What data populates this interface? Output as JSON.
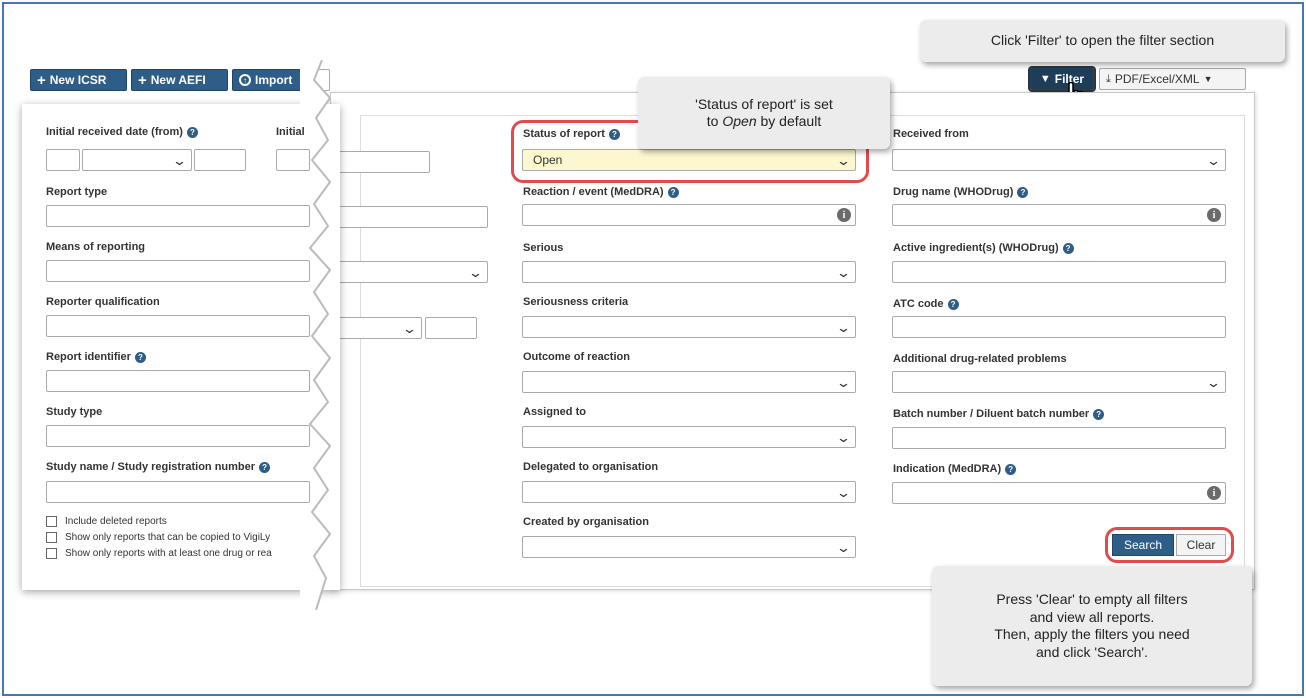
{
  "toolbar": {
    "new_icsr": "New ICSR",
    "new_aefi": "New AEFI",
    "import": "Import",
    "filter": "Filter",
    "export": "PDF/Excel/XML"
  },
  "left": {
    "initial_received_from": "Initial received date (from)",
    "initial_trunc": "Initial",
    "report_type": "Report type",
    "means_of_reporting": "Means of reporting",
    "reporter_qualification": "Reporter qualification",
    "report_identifier": "Report identifier",
    "study_type": "Study type",
    "study_name": "Study name / Study registration number",
    "checkboxes": [
      "Include deleted reports",
      "Show only reports that can be copied to VigiLy",
      "Show only reports with at least one drug or rea"
    ]
  },
  "middle": {
    "status_of_report": "Status of report",
    "status_value": "Open",
    "reaction_event": "Reaction / event (MedDRA)",
    "serious": "Serious",
    "seriousness_criteria": "Seriousness criteria",
    "outcome_of_reaction": "Outcome of reaction",
    "assigned_to": "Assigned to",
    "delegated_to_org": "Delegated to organisation",
    "created_by_org": "Created by organisation"
  },
  "right": {
    "received_from": "Received from",
    "drug_name": "Drug name (WHODrug)",
    "active_ingredient": "Active ingredient(s) (WHODrug)",
    "atc_code": "ATC code",
    "additional_drug": "Additional drug-related problems",
    "batch_number": "Batch number / Diluent batch number",
    "indication": "Indication (MedDRA)"
  },
  "buttons": {
    "search": "Search",
    "clear": "Clear"
  },
  "callouts": {
    "filter_tip": "Click 'Filter' to open the filter section",
    "status_tip_1": "'Status of report' is set",
    "status_tip_2_pre": "to ",
    "status_tip_2_em": "Open",
    "status_tip_2_post": " by default",
    "clear_tip_1": "Press 'Clear' to empty all filters",
    "clear_tip_2": "and view all reports.",
    "clear_tip_3": "Then, apply the filters you need",
    "clear_tip_4": "and click 'Search'."
  },
  "colors": {
    "primary": "#2e5d87",
    "highlight": "#e24b4b",
    "status_bg": "#fdf7cf",
    "frame": "#4a74b4"
  }
}
